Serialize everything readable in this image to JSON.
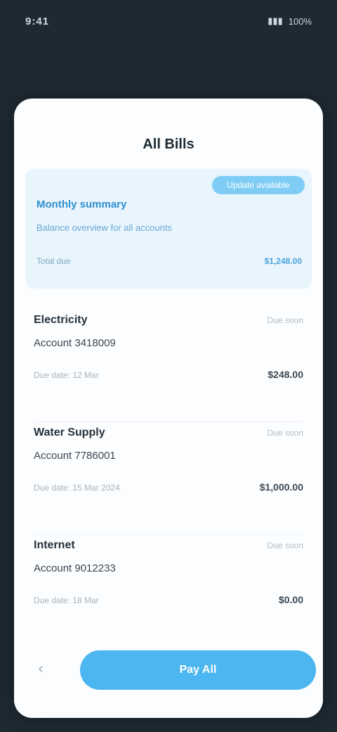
{
  "status": {
    "time": "9:41",
    "signal": "▮▮▮",
    "battery": "100%"
  },
  "sheet": {
    "title": "All Bills",
    "summary": {
      "badge": "Update available",
      "heading": "Monthly summary",
      "subtext": "Balance overview for all accounts",
      "label": "Total due",
      "value": "$1,248.00"
    },
    "items": [
      {
        "title": "Electricity",
        "desc": "Account 3418009",
        "tag": "Due soon",
        "meta": "Due date: 12 Mar",
        "amount": "$248.00"
      },
      {
        "title": "Water Supply",
        "desc": "Account 7786001",
        "tag": "Due soon",
        "meta": "Due date: 15 Mar 2024",
        "amount": "$1,000.00"
      },
      {
        "title": "Internet",
        "desc": "Account 9012233",
        "tag": "Due soon",
        "meta": "Due date: 18 Mar",
        "amount": "$0.00"
      }
    ]
  },
  "actions": {
    "back_icon": "chevron-left-icon",
    "primary_label": "Pay All"
  }
}
